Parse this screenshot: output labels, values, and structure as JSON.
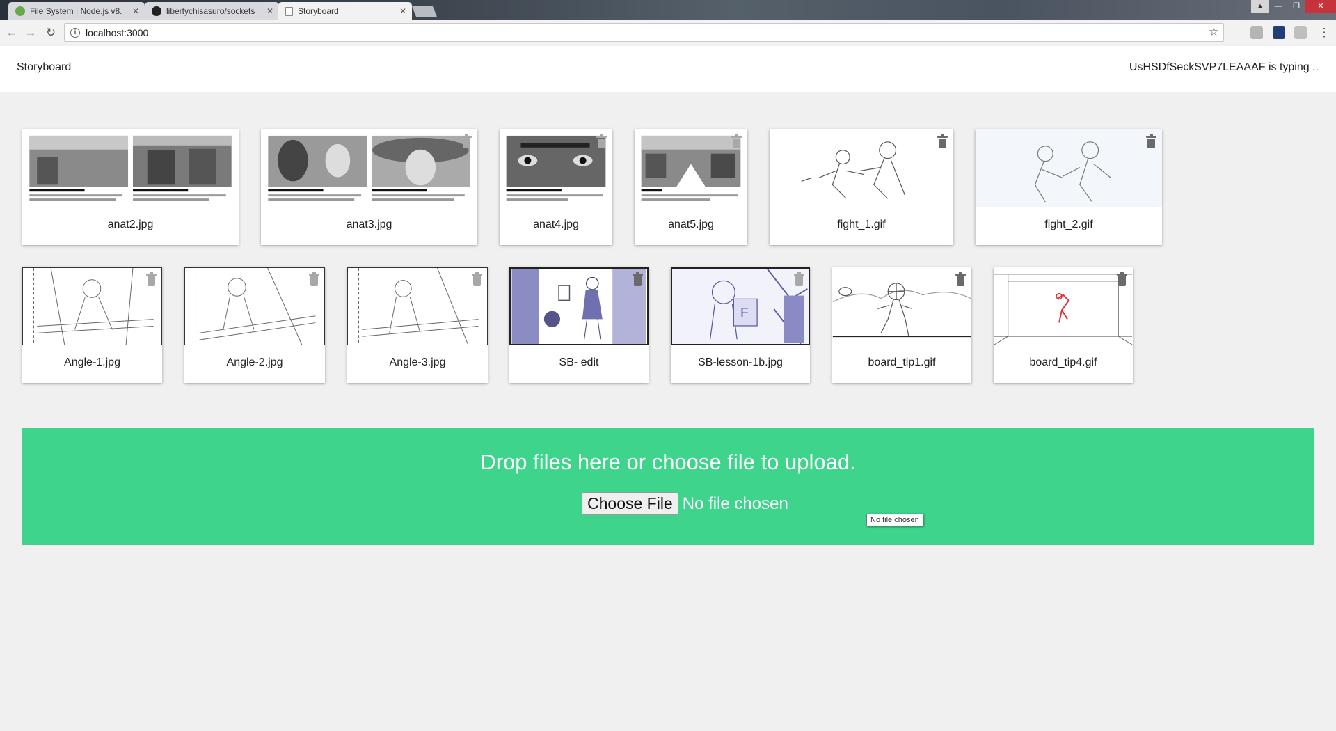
{
  "browser": {
    "tabs": [
      {
        "title": "File System | Node.js v8.",
        "close": "✕",
        "favicon_color": "#6aa84f"
      },
      {
        "title": "libertychisasuro/sockets",
        "close": "✕",
        "favicon_color": "#222222"
      },
      {
        "title": "Storyboard",
        "close": "✕",
        "favicon_color": "#ffffff"
      }
    ],
    "url": "localhost:3000"
  },
  "header": {
    "title": "Storyboard",
    "status": "UsHSDfSeckSVP7LEAAAF is typing .."
  },
  "gallery": {
    "row1": [
      {
        "name": "anat2.jpg",
        "thumb": "comic-two-panel-street"
      },
      {
        "name": "anat3.jpg",
        "thumb": "comic-two-panel-faces"
      },
      {
        "name": "anat4.jpg",
        "thumb": "comic-extreme-closeup"
      },
      {
        "name": "anat5.jpg",
        "thumb": "comic-birds-eye"
      },
      {
        "name": "fight_1.gif",
        "thumb": "sketch-fight"
      },
      {
        "name": "fight_2.gif",
        "thumb": "sketch-fight"
      }
    ],
    "row2": [
      {
        "name": "Angle-1.jpg",
        "thumb": "sketch-window-woman"
      },
      {
        "name": "Angle-2.jpg",
        "thumb": "sketch-window-woman"
      },
      {
        "name": "Angle-3.jpg",
        "thumb": "sketch-window-woman"
      },
      {
        "name": "SB- edit",
        "thumb": "blue-sketch-room"
      },
      {
        "name": "SB-lesson-1b.jpg",
        "thumb": "blue-sketch-kid"
      },
      {
        "name": "board_tip1.gif",
        "thumb": "sketch-runner"
      },
      {
        "name": "board_tip4.gif",
        "thumb": "sketch-stage-red"
      }
    ],
    "delete_icon": "trash-icon"
  },
  "upload": {
    "prompt": "Drop files here or choose file to upload.",
    "button_label": "Choose File",
    "file_status": "No file chosen",
    "tooltip": "No file chosen"
  },
  "colors": {
    "dropzone": "#3ed48c",
    "page_bg": "#f0f0f0"
  }
}
